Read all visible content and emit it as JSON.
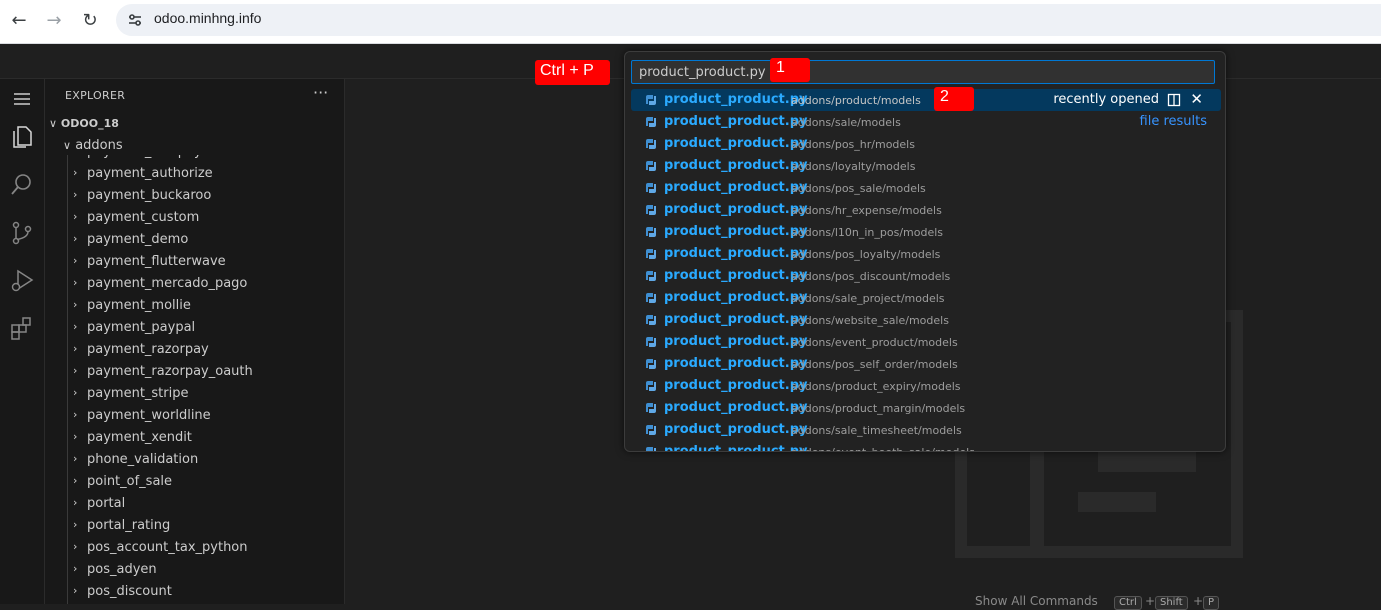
{
  "browser": {
    "url": "odoo.minhng.info",
    "back_glyph": "←",
    "forward_glyph": "→",
    "reload_glyph": "↻"
  },
  "sidebar": {
    "title": "EXPLORER",
    "more_glyph": "···",
    "folder_chevron": "∨",
    "folder": "ODOO_18",
    "addons_chevron": "∨",
    "addons": "addons",
    "items": [
      "payment_asiapay",
      "payment_authorize",
      "payment_buckaroo",
      "payment_custom",
      "payment_demo",
      "payment_flutterwave",
      "payment_mercado_pago",
      "payment_mollie",
      "payment_paypal",
      "payment_razorpay",
      "payment_razorpay_oauth",
      "payment_stripe",
      "payment_worldline",
      "payment_xendit",
      "phone_validation",
      "point_of_sale",
      "portal",
      "portal_rating",
      "pos_account_tax_python",
      "pos_adyen",
      "pos_discount"
    ],
    "item_chevron": "›"
  },
  "activity_icons": [
    "menu-icon",
    "files-icon",
    "search-icon",
    "source-control-icon",
    "run-debug-icon",
    "extensions-icon"
  ],
  "quick_open": {
    "query": "product_product.py",
    "recently_opened_label": "recently opened",
    "file_results_label": "file results",
    "close_glyph": "✕",
    "results": [
      {
        "name": "product_product.py",
        "path": "addons/product/models"
      },
      {
        "name": "product_product.py",
        "path": "addons/sale/models"
      },
      {
        "name": "product_product.py",
        "path": "addons/pos_hr/models"
      },
      {
        "name": "product_product.py",
        "path": "addons/loyalty/models"
      },
      {
        "name": "product_product.py",
        "path": "addons/pos_sale/models"
      },
      {
        "name": "product_product.py",
        "path": "addons/hr_expense/models"
      },
      {
        "name": "product_product.py",
        "path": "addons/l10n_in_pos/models"
      },
      {
        "name": "product_product.py",
        "path": "addons/pos_loyalty/models"
      },
      {
        "name": "product_product.py",
        "path": "addons/pos_discount/models"
      },
      {
        "name": "product_product.py",
        "path": "addons/sale_project/models"
      },
      {
        "name": "product_product.py",
        "path": "addons/website_sale/models"
      },
      {
        "name": "product_product.py",
        "path": "addons/event_product/models"
      },
      {
        "name": "product_product.py",
        "path": "addons/pos_self_order/models"
      },
      {
        "name": "product_product.py",
        "path": "addons/product_expiry/models"
      },
      {
        "name": "product_product.py",
        "path": "addons/product_margin/models"
      },
      {
        "name": "product_product.py",
        "path": "addons/sale_timesheet/models"
      },
      {
        "name": "product_product.py",
        "path": "addons/event_booth_sale/models"
      }
    ]
  },
  "annotations": {
    "shortcut": "Ctrl + P",
    "step1": "1",
    "step2": "2"
  },
  "editor_hint": {
    "label": "Show All Commands",
    "keys": [
      "Ctrl",
      "+",
      "Shift",
      "+",
      "P"
    ]
  },
  "colors": {
    "accent": "#0078d4",
    "selected_row": "#04395e",
    "filename": "#2aaaff",
    "annotation": "#ff0000"
  }
}
